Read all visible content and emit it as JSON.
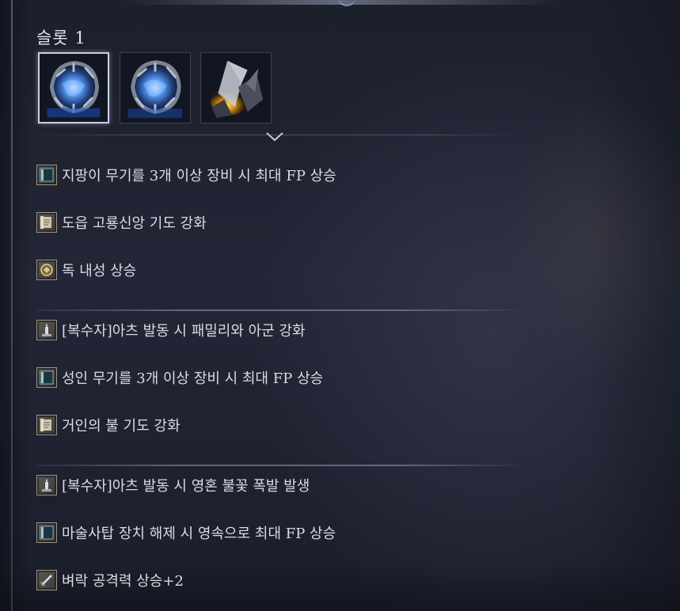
{
  "slot": {
    "title": "슬롯 1",
    "gems": [
      {
        "icon": "blue-crystal-orb-icon",
        "selected": true,
        "color": "#3b7bd6"
      },
      {
        "icon": "blue-crystal-orb-icon",
        "selected": false,
        "color": "#3b7bd6"
      },
      {
        "icon": "yellow-shard-crystal-icon",
        "selected": false,
        "color": "#e0a824"
      }
    ]
  },
  "effects": [
    {
      "icon": "fp-bar-icon",
      "text": "지팡이 무기를 3개 이상 장비 시 최대 FP 상승"
    },
    {
      "icon": "scroll-icon",
      "text": "도읍 고룡신앙 기도 강화"
    },
    {
      "icon": "poison-resist-icon",
      "text": "독 내성 상승"
    },
    {
      "icon": "ritual-candle-icon",
      "text": "[복수자]아츠 발동 시 패밀리와 아군 강화"
    },
    {
      "icon": "fp-bar-icon",
      "text": "성인 무기를 3개 이상 장비 시 최대 FP 상승"
    },
    {
      "icon": "scroll-icon",
      "text": "거인의 불 기도 강화"
    },
    {
      "icon": "ritual-candle-icon",
      "text": "[복수자]아츠 발동 시 영혼 불꽃 폭발 발생"
    },
    {
      "icon": "fp-bar-icon",
      "text": "마술사탑 장치 해제 시 영속으로 최대 FP 상승"
    },
    {
      "icon": "sword-icon",
      "text": "벼락 공격력 상승+2"
    }
  ]
}
